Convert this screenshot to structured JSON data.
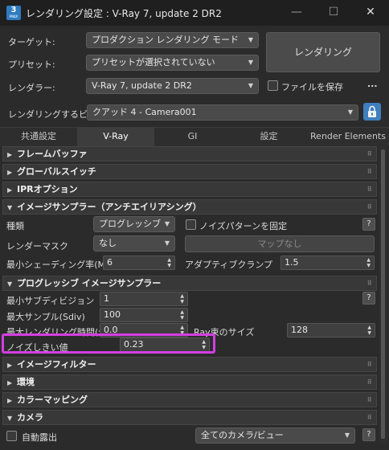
{
  "titlebar": {
    "app_icon_text": "3",
    "app_icon_sub": "MAX",
    "title": "レンダリング設定 : V-Ray 7, update 2 DR2",
    "minimize": "—",
    "maximize": "☐",
    "close": "✕"
  },
  "top": {
    "target_label": "ターゲット:",
    "target_value": "プロダクション レンダリング モード",
    "preset_label": "プリセット:",
    "preset_value": "プリセットが選択されていない",
    "renderer_label": "レンダラー:",
    "renderer_value": "V-Ray 7, update 2 DR2",
    "render_button": "レンダリング",
    "save_file_label": "ファイルを保存",
    "more": "...",
    "view_label": "レンダリングするビュー:",
    "view_value": "クアッド 4 - Camera001"
  },
  "tabs": [
    "共通設定",
    "V-Ray",
    "GI",
    "設定",
    "Render Elements"
  ],
  "rollouts": {
    "framebuffer": "フレームバッファ",
    "global_switches": "グローバルスイッチ",
    "ipr": "IPRオプション",
    "image_sampler": "イメージサンプラー（アンチエイリアシング）",
    "progressive": "プログレッシブ イメージサンプラー",
    "image_filter": "イメージフィルター",
    "environment": "環境",
    "color_mapping": "カラーマッピング",
    "camera": "カメラ"
  },
  "image_sampler": {
    "type_label": "種類",
    "type_value": "プログレッシブ",
    "lock_noise_label": "ノイズパターンを固定",
    "help": "?",
    "render_mask_label": "レンダーマスク",
    "render_mask_value": "なし",
    "no_map_button": "マップなし",
    "min_shading_label": "最小シェーディング率(MSR)",
    "min_shading_value": "6",
    "adaptive_clamp_label": "アダプティブクランプ",
    "adaptive_clamp_value": "1.5"
  },
  "progressive": {
    "min_subdiv_label": "最小サブディビジョン",
    "min_subdiv_value": "1",
    "help": "?",
    "max_subdiv_label": "最大サンプル(Sdiv)",
    "max_subdiv_value": "100",
    "max_time_label": "最大レンダリング時間(分)",
    "max_time_value": "0.0",
    "ray_bundle_label": "Ray束のサイズ",
    "ray_bundle_value": "128",
    "noise_label": "ノイズしきい値",
    "noise_value": "0.23"
  },
  "camera": {
    "auto_exposure_label": "自動露出",
    "camera_select_value": "全てのカメラ/ビュー",
    "help": "?"
  },
  "colors": {
    "highlight": "#d43ee2",
    "lock": "#3f7fbf"
  }
}
